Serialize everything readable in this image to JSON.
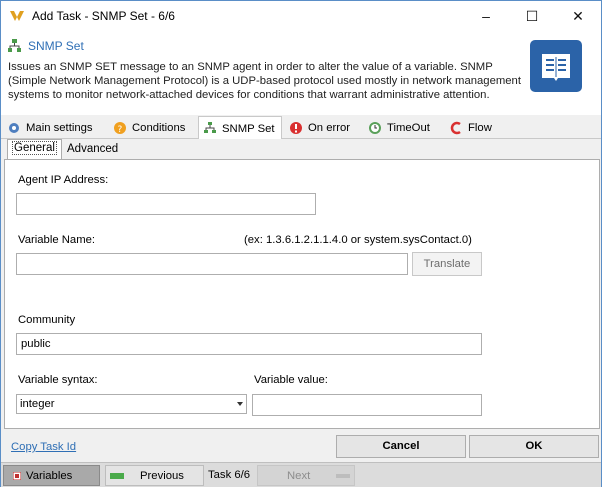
{
  "window": {
    "title": "Add Task - SNMP Set - 6/6",
    "minimize_glyph": "–",
    "maximize_glyph": "☐",
    "close_glyph": "✕"
  },
  "header": {
    "title": "SNMP Set",
    "description": "Issues an SNMP SET message to an SNMP agent in order to alter the value of a variable. SNMP (Simple Network Management Protocol) is a UDP-based protocol used mostly in network management systems to monitor network-attached devices for conditions that warrant administrative attention."
  },
  "tabs": [
    {
      "label": "Main settings",
      "icon": "gear-icon"
    },
    {
      "label": "Conditions",
      "icon": "question-icon"
    },
    {
      "label": "SNMP Set",
      "icon": "network-icon",
      "active": true
    },
    {
      "label": "On error",
      "icon": "error-icon"
    },
    {
      "label": "TimeOut",
      "icon": "timeout-icon"
    },
    {
      "label": "Flow",
      "icon": "flow-icon"
    }
  ],
  "subtabs": [
    {
      "label": "General",
      "active": true
    },
    {
      "label": "Advanced"
    }
  ],
  "form": {
    "agent_ip_label": "Agent IP Address:",
    "agent_ip_value": "",
    "variable_name_label": "Variable Name:",
    "variable_name_hint": "(ex: 1.3.6.1.2.1.1.4.0 or system.sysContact.0)",
    "variable_name_value": "",
    "translate_button": "Translate",
    "community_label": "Community",
    "community_value": "public",
    "syntax_label": "Variable syntax:",
    "syntax_value": "integer",
    "value_label": "Variable value:",
    "value_value": ""
  },
  "footer": {
    "copy_link": "Copy Task Id",
    "cancel_button": "Cancel",
    "ok_button": "OK"
  },
  "statusbar": {
    "variables": "Variables",
    "previous": "Previous",
    "task_counter": "Task 6/6",
    "next": "Next"
  },
  "colors": {
    "accent": "#2f6fb5",
    "badge": "#2b63a8",
    "window_border": "#5a8ec7"
  }
}
